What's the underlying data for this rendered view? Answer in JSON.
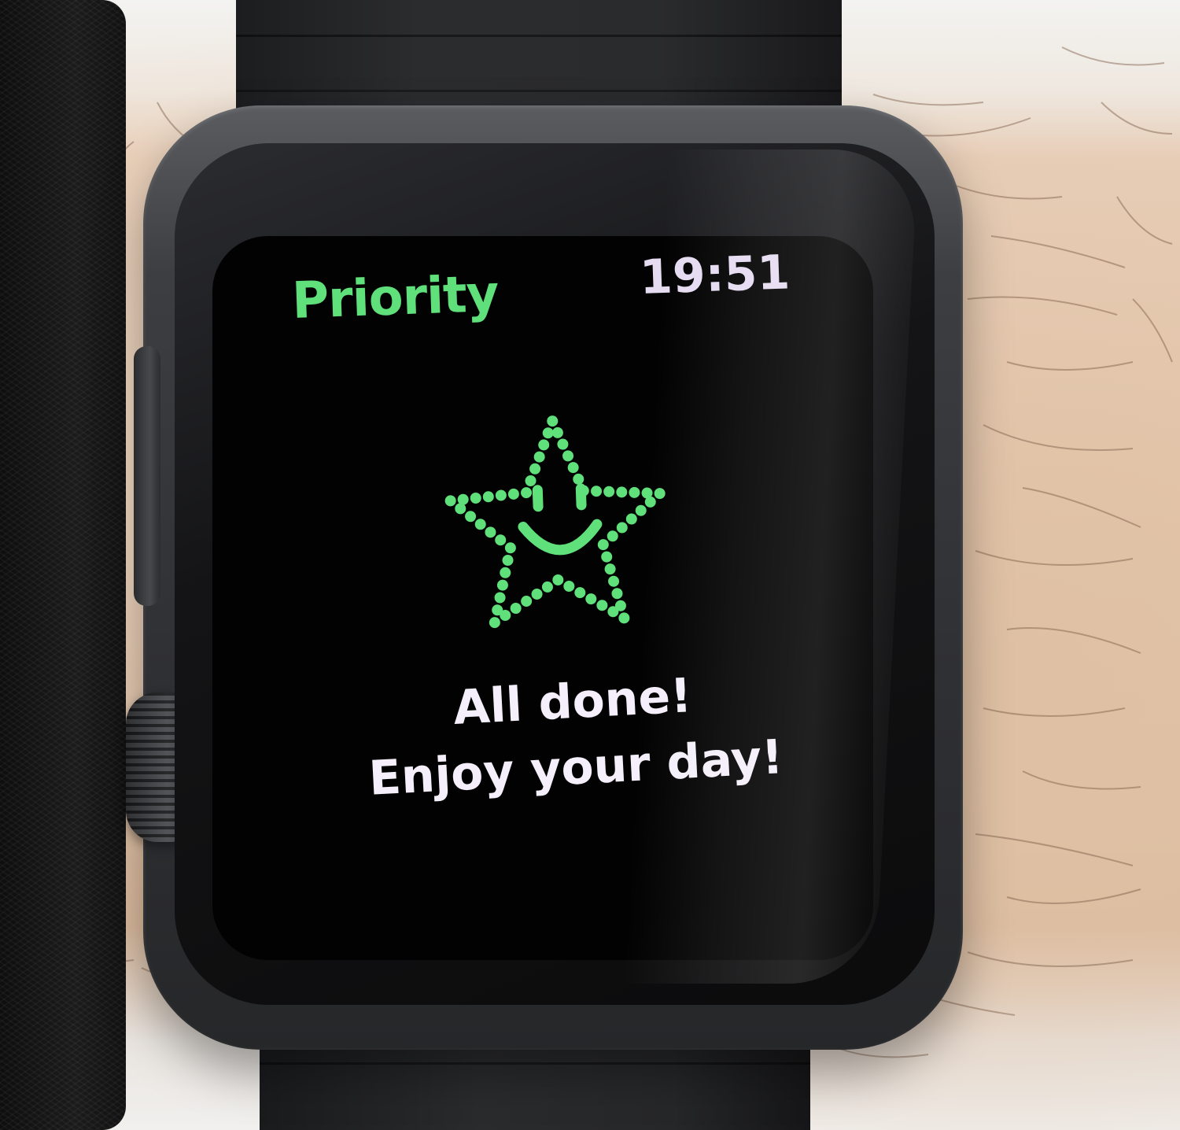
{
  "header": {
    "app_title": "Priority",
    "time": "19:51"
  },
  "main": {
    "icon": "smiling-star-icon",
    "message_line1": "All done!",
    "message_line2": "Enjoy your day!"
  },
  "colors": {
    "accent": "#5fe07a",
    "time_text": "#e6dcf2",
    "message_text": "#f4effa",
    "display_background": "#020202"
  }
}
